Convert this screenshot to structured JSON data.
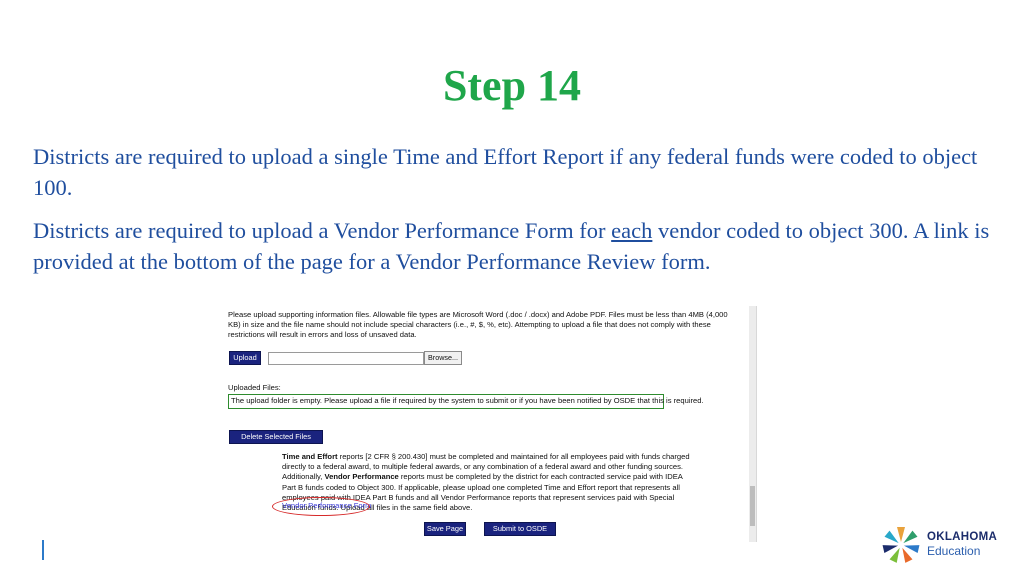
{
  "slide": {
    "title": "Step 14",
    "paragraph1": "Districts are required to upload a single Time and Effort Report if any federal funds were coded to object 100.",
    "paragraph2_before": "Districts are required to upload a Vendor Performance Form for ",
    "paragraph2_underlined": "each",
    "paragraph2_after": " vendor coded to object 300.  A link is provided at the bottom of the page for a Vendor Performance Review form."
  },
  "screenshot": {
    "instructions": "Please upload supporting information files. Allowable file types are Microsoft Word (.doc / .docx) and Adobe PDF. Files must be less than 4MB (4,000 KB) in size and the file name should not include special characters (i.e., #, $, %, etc). Attempting to upload a file that does not comply with these restrictions will result in errors and loss of unsaved data.",
    "upload_button": "Upload",
    "file_input_value": "",
    "browse_button": "Browse...",
    "uploaded_files_label": "Uploaded Files:",
    "empty_message": "The upload folder is empty. Please upload a file if required by the system to submit or if you have been notified by OSDE that this is required.",
    "delete_button": "Delete Selected Files",
    "te_bold1": "Time and Effort",
    "te_text1": " reports [2 CFR § 200.430] must be completed and maintained for all employees paid with funds charged directly to a federal award, to multiple federal awards, or any combination of a federal award and other funding sources. Additionally, ",
    "te_bold2": "Vendor Performance",
    "te_text2": " reports must be completed by the district for each contracted service paid with IDEA Part B funds coded to Object 300. If applicable, please upload one completed Time and Effort report that represents all employees paid with IDEA Part B funds and all Vendor Performance reports that represent services paid with Special Education funds. Upload all files in the same field above.",
    "vendor_link": "Vendor Performance Form",
    "save_button": "Save Page",
    "submit_button": "Submit to OSDE"
  },
  "logo": {
    "line1": "OKLAHOMA",
    "line2": "Education"
  },
  "colors": {
    "title": "#1fa64a",
    "body_text": "#1f4e9e",
    "button": "#1a237e",
    "highlight_box": "#2e8b2e",
    "ellipse": "#d62a2a",
    "link": "#3b3bd6"
  }
}
